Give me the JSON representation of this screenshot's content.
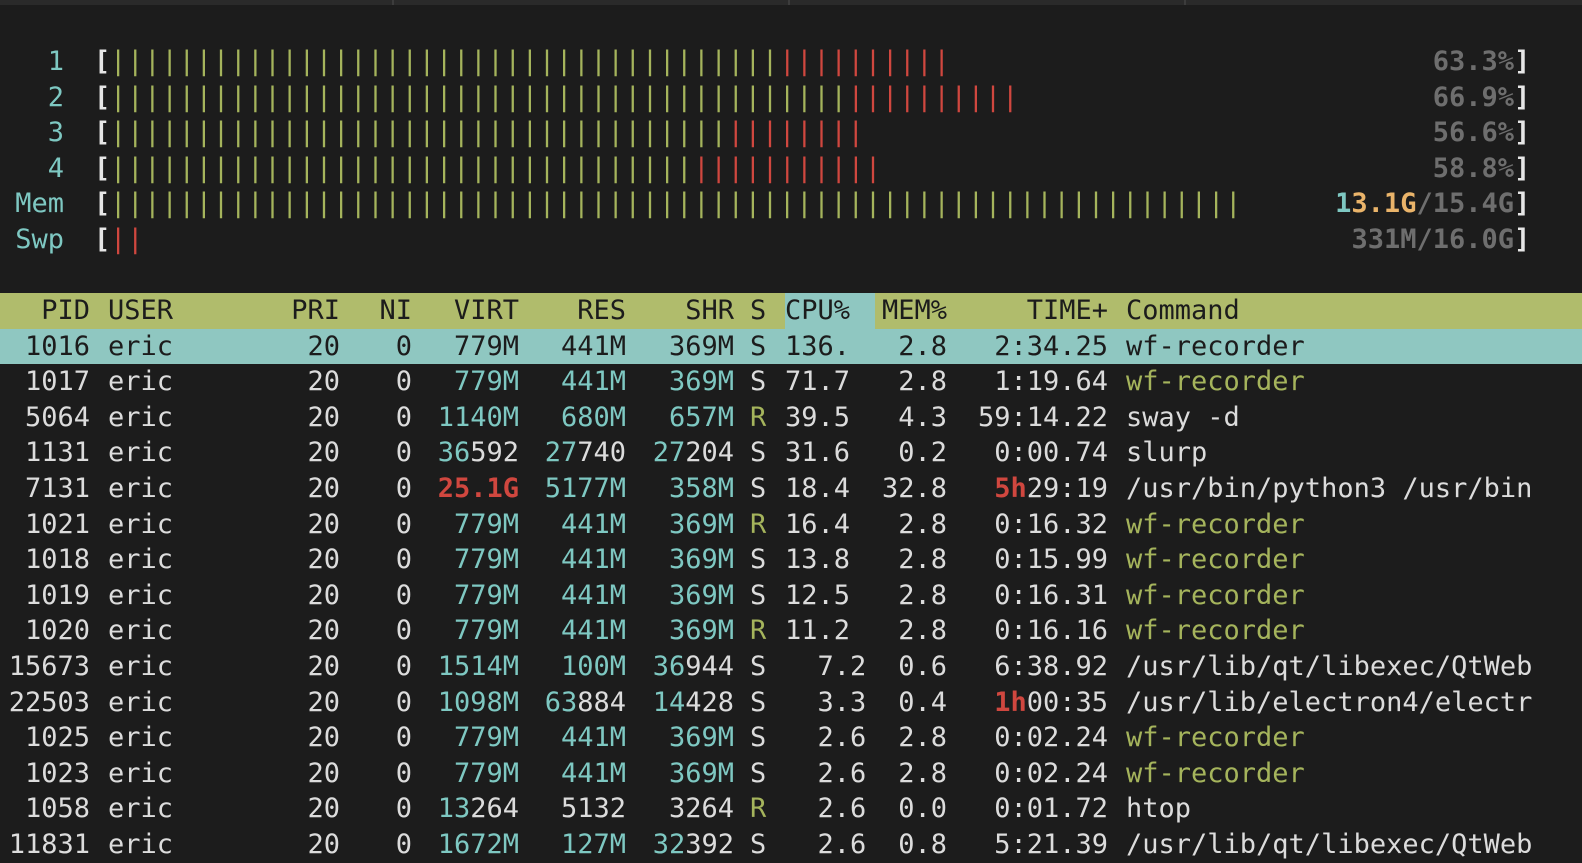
{
  "meters": [
    {
      "label": "1",
      "text": "63.3%",
      "normal_fraction": 0.5,
      "kernel_fraction": 0.133
    },
    {
      "label": "2",
      "text": "66.9%",
      "normal_fraction": 0.547,
      "kernel_fraction": 0.122
    },
    {
      "label": "3",
      "text": "56.6%",
      "normal_fraction": 0.466,
      "kernel_fraction": 0.1
    },
    {
      "label": "4",
      "text": "58.8%",
      "normal_fraction": 0.442,
      "kernel_fraction": 0.146
    }
  ],
  "mem": {
    "label": "Mem",
    "used_a": "1",
    "used_b": "3.1G",
    "total": "/15.4G",
    "fraction": 0.85
  },
  "swp": {
    "label": "Swp",
    "text": "331M/16.0G",
    "fraction": 0.021
  },
  "bracket_open": "[",
  "bracket_close": "]",
  "header": {
    "pid": "PID",
    "user": "USER",
    "pri": "PRI",
    "ni": "NI",
    "virt": "VIRT",
    "res": "RES",
    "shr": "SHR",
    "s": "S",
    "cpu": "CPU%",
    "mem": "MEM%",
    "time": "TIME+",
    "command": "Command"
  },
  "processes": [
    {
      "pid": "1016",
      "user": "eric",
      "pri": "20",
      "ni": "0",
      "virt": [
        "",
        "779M"
      ],
      "res": [
        "",
        "441M"
      ],
      "shr": [
        "",
        "369M"
      ],
      "s": "S",
      "cpu": "136.",
      "mem": "2.8",
      "time": [
        "",
        "2:34.25"
      ],
      "cmd": "wf-recorder",
      "cmd_style": "thread",
      "selected": true
    },
    {
      "pid": "1017",
      "user": "eric",
      "pri": "20",
      "ni": "0",
      "virt": [
        "",
        "779M"
      ],
      "res": [
        "",
        "441M"
      ],
      "shr": [
        "",
        "369M"
      ],
      "s": "S",
      "cpu": "71.7",
      "mem": "2.8",
      "time": [
        "",
        "1:19.64"
      ],
      "cmd": "wf-recorder",
      "cmd_style": "thread"
    },
    {
      "pid": "5064",
      "user": "eric",
      "pri": "20",
      "ni": "0",
      "virt": [
        "",
        "1140M"
      ],
      "res": [
        "",
        "680M"
      ],
      "shr": [
        "",
        "657M"
      ],
      "s": "R",
      "cpu": "39.5",
      "mem": "4.3",
      "time": [
        "",
        "59:14.22"
      ],
      "cmd": "sway -d",
      "cmd_style": "normal"
    },
    {
      "pid": "1131",
      "user": "eric",
      "pri": "20",
      "ni": "0",
      "virt": [
        "36",
        "592"
      ],
      "res": [
        "27",
        "740"
      ],
      "shr": [
        "27",
        "204"
      ],
      "s": "S",
      "cpu": "31.6",
      "mem": "0.2",
      "time": [
        "",
        "0:00.74"
      ],
      "cmd": "slurp",
      "cmd_style": "normal"
    },
    {
      "pid": "7131",
      "user": "eric",
      "pri": "20",
      "ni": "0",
      "virt": [
        "",
        "25.1G"
      ],
      "virt_red": true,
      "res": [
        "",
        "5177M"
      ],
      "shr": [
        "",
        "358M"
      ],
      "s": "S",
      "cpu": "18.4",
      "mem": "32.8",
      "time": [
        "5h",
        "29:19"
      ],
      "cmd": "/usr/bin/python3 /usr/bin",
      "cmd_style": "normal"
    },
    {
      "pid": "1021",
      "user": "eric",
      "pri": "20",
      "ni": "0",
      "virt": [
        "",
        "779M"
      ],
      "res": [
        "",
        "441M"
      ],
      "shr": [
        "",
        "369M"
      ],
      "s": "R",
      "cpu": "16.4",
      "mem": "2.8",
      "time": [
        "",
        "0:16.32"
      ],
      "cmd": "wf-recorder",
      "cmd_style": "thread"
    },
    {
      "pid": "1018",
      "user": "eric",
      "pri": "20",
      "ni": "0",
      "virt": [
        "",
        "779M"
      ],
      "res": [
        "",
        "441M"
      ],
      "shr": [
        "",
        "369M"
      ],
      "s": "S",
      "cpu": "13.8",
      "mem": "2.8",
      "time": [
        "",
        "0:15.99"
      ],
      "cmd": "wf-recorder",
      "cmd_style": "thread"
    },
    {
      "pid": "1019",
      "user": "eric",
      "pri": "20",
      "ni": "0",
      "virt": [
        "",
        "779M"
      ],
      "res": [
        "",
        "441M"
      ],
      "shr": [
        "",
        "369M"
      ],
      "s": "S",
      "cpu": "12.5",
      "mem": "2.8",
      "time": [
        "",
        "0:16.31"
      ],
      "cmd": "wf-recorder",
      "cmd_style": "thread"
    },
    {
      "pid": "1020",
      "user": "eric",
      "pri": "20",
      "ni": "0",
      "virt": [
        "",
        "779M"
      ],
      "res": [
        "",
        "441M"
      ],
      "shr": [
        "",
        "369M"
      ],
      "s": "R",
      "cpu": "11.2",
      "mem": "2.8",
      "time": [
        "",
        "0:16.16"
      ],
      "cmd": "wf-recorder",
      "cmd_style": "thread"
    },
    {
      "pid": "15673",
      "user": "eric",
      "pri": "20",
      "ni": "0",
      "virt": [
        "",
        "1514M"
      ],
      "res": [
        "",
        "100M"
      ],
      "shr": [
        "36",
        "944"
      ],
      "s": "S",
      "cpu": "  7.2",
      "mem": "0.6",
      "time": [
        "",
        "6:38.92"
      ],
      "cmd": "/usr/lib/qt/libexec/QtWeb",
      "cmd_style": "normal"
    },
    {
      "pid": "22503",
      "user": "eric",
      "pri": "20",
      "ni": "0",
      "virt": [
        "",
        "1098M"
      ],
      "res": [
        "63",
        "884"
      ],
      "shr": [
        "14",
        "428"
      ],
      "s": "S",
      "cpu": "  3.3",
      "mem": "0.4",
      "time": [
        "1h",
        "00:35"
      ],
      "cmd": "/usr/lib/electron4/electr",
      "cmd_style": "normal"
    },
    {
      "pid": "1025",
      "user": "eric",
      "pri": "20",
      "ni": "0",
      "virt": [
        "",
        "779M"
      ],
      "res": [
        "",
        "441M"
      ],
      "shr": [
        "",
        "369M"
      ],
      "s": "S",
      "cpu": "  2.6",
      "mem": "2.8",
      "time": [
        "",
        "0:02.24"
      ],
      "cmd": "wf-recorder",
      "cmd_style": "thread"
    },
    {
      "pid": "1023",
      "user": "eric",
      "pri": "20",
      "ni": "0",
      "virt": [
        "",
        "779M"
      ],
      "res": [
        "",
        "441M"
      ],
      "shr": [
        "",
        "369M"
      ],
      "s": "S",
      "cpu": "  2.6",
      "mem": "2.8",
      "time": [
        "",
        "0:02.24"
      ],
      "cmd": "wf-recorder",
      "cmd_style": "thread"
    },
    {
      "pid": "1058",
      "user": "eric",
      "pri": "20",
      "ni": "0",
      "virt": [
        "13",
        "264"
      ],
      "res": [
        "",
        "5132"
      ],
      "shr": [
        "",
        "3264"
      ],
      "s": "R",
      "cpu": "  2.6",
      "mem": "0.0",
      "time": [
        "",
        "0:01.72"
      ],
      "cmd": "htop",
      "cmd_style": "normal"
    },
    {
      "pid": "11831",
      "user": "eric",
      "pri": "20",
      "ni": "0",
      "virt": [
        "",
        "1672M"
      ],
      "res": [
        "",
        "127M"
      ],
      "shr": [
        "32",
        "392"
      ],
      "s": "S",
      "cpu": "  2.6",
      "mem": "0.8",
      "time": [
        "",
        "5:21.39"
      ],
      "cmd": "/usr/lib/qt/libexec/QtWeb",
      "cmd_style": "normal"
    }
  ],
  "colors": {
    "normal_bar": "#a5b45c",
    "kernel_bar": "#d0473f",
    "header_bg": "#b0bc6c",
    "selected_bg": "#8fc7c1"
  }
}
